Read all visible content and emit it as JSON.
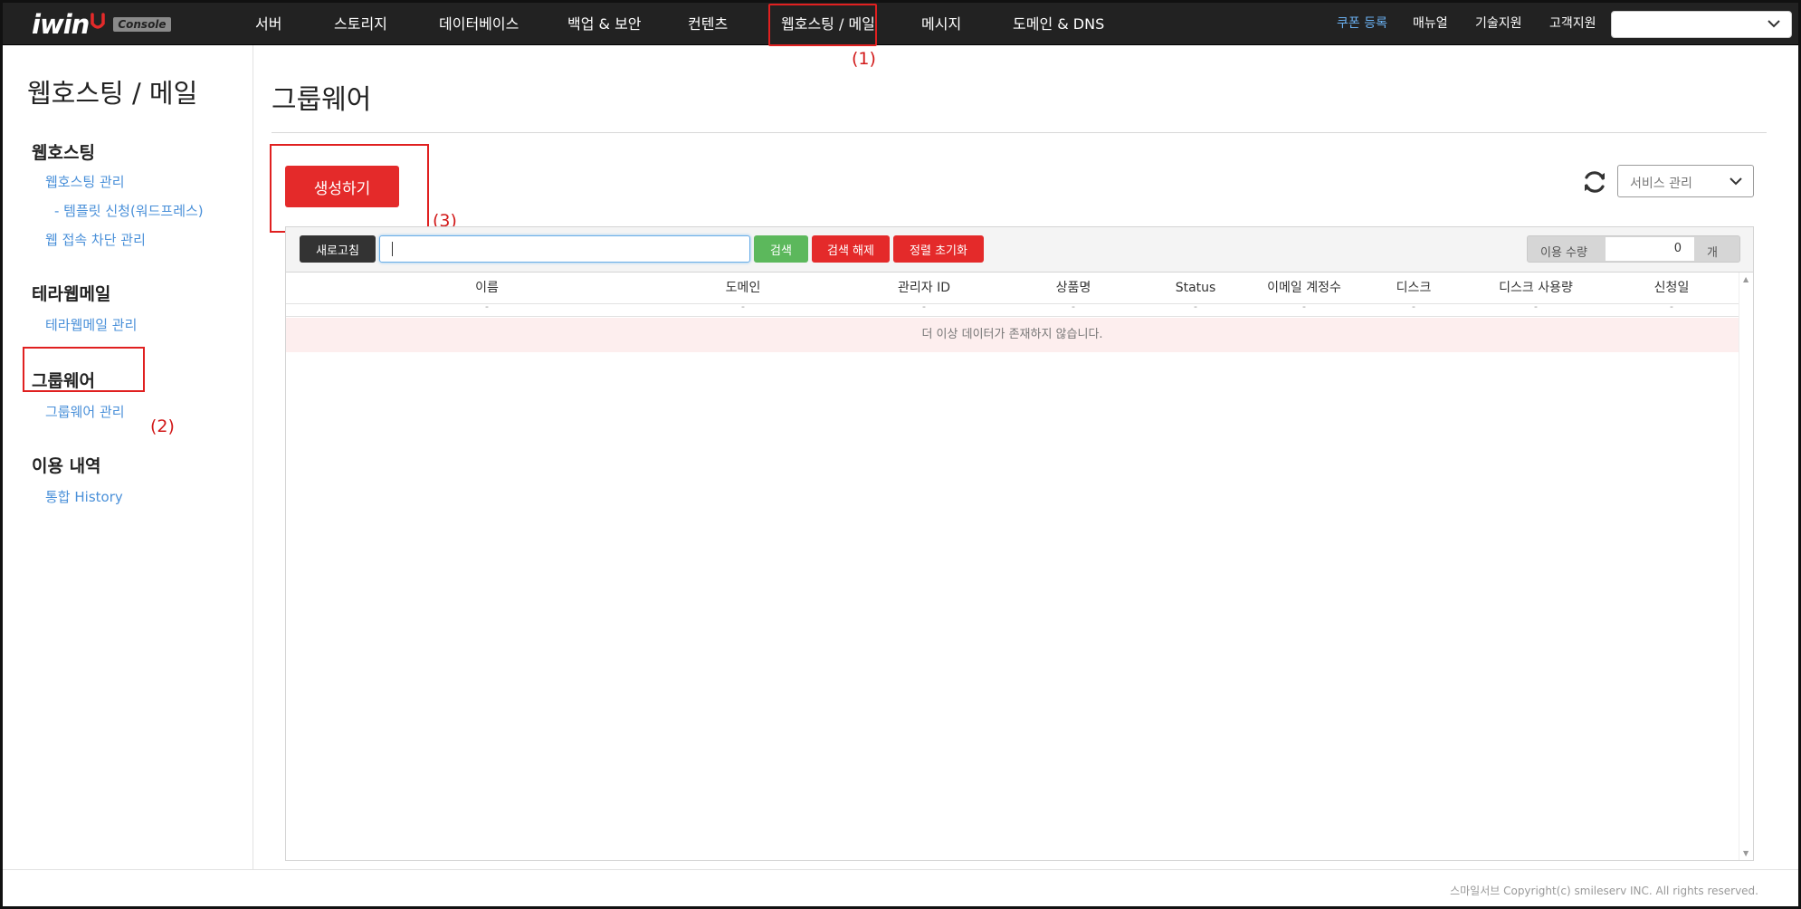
{
  "brand": {
    "logo_text": "iwin",
    "badge": "Console",
    "accent_color": "#e42a2a"
  },
  "nav": {
    "items": [
      {
        "label": "서버"
      },
      {
        "label": "스토리지"
      },
      {
        "label": "데이터베이스"
      },
      {
        "label": "백업 & 보안"
      },
      {
        "label": "컨텐츠"
      },
      {
        "label": "웹호스팅 / 메일"
      },
      {
        "label": "메시지"
      },
      {
        "label": "도메인 & DNS"
      }
    ],
    "util": {
      "coupon": "쿠폰 등록",
      "manual": "매뉴얼",
      "tech": "기술지원",
      "support": "고객지원"
    },
    "account_select_value": ""
  },
  "markers": {
    "m1": "(1)",
    "m2": "(2)",
    "m3": "(3)"
  },
  "sidebar": {
    "title": "웹호스팅 / 메일",
    "groups": [
      {
        "title": "웹호스팅",
        "links": [
          "웹호스팅 관리",
          "- 템플릿 신청(워드프레스)",
          "웹 접속 차단 관리"
        ]
      },
      {
        "title": "테라웹메일",
        "links": [
          "테라웹메일 관리"
        ]
      },
      {
        "title": "그룹웨어",
        "links": [
          "그룹웨어 관리"
        ]
      },
      {
        "title": "이용 내역",
        "links": [
          "통합 History"
        ]
      }
    ]
  },
  "main": {
    "title": "그룹웨어",
    "create_button": "생성하기",
    "service_select": "서비스 관리",
    "toolbar": {
      "refresh": "새로고침",
      "search_value": "",
      "search": "검색",
      "search_clear": "검색 해제",
      "sort_reset": "정렬 초기화",
      "usage_label": "이용 수량",
      "usage_value": "0",
      "usage_unit": "개"
    },
    "columns": [
      "이름",
      "도메인",
      "관리자 ID",
      "상품명",
      "Status",
      "이메일 계정수",
      "디스크",
      "디스크 사용량",
      "신청일"
    ],
    "filter_placeholders": [
      "-",
      "-",
      "-",
      "-",
      "-",
      "-",
      "-",
      "-",
      "-"
    ],
    "empty_message": "더 이상 데이터가 존재하지 않습니다."
  },
  "footer": {
    "copyright": "스마일서브 Copyright(c) smileserv INC. All rights reserved."
  }
}
